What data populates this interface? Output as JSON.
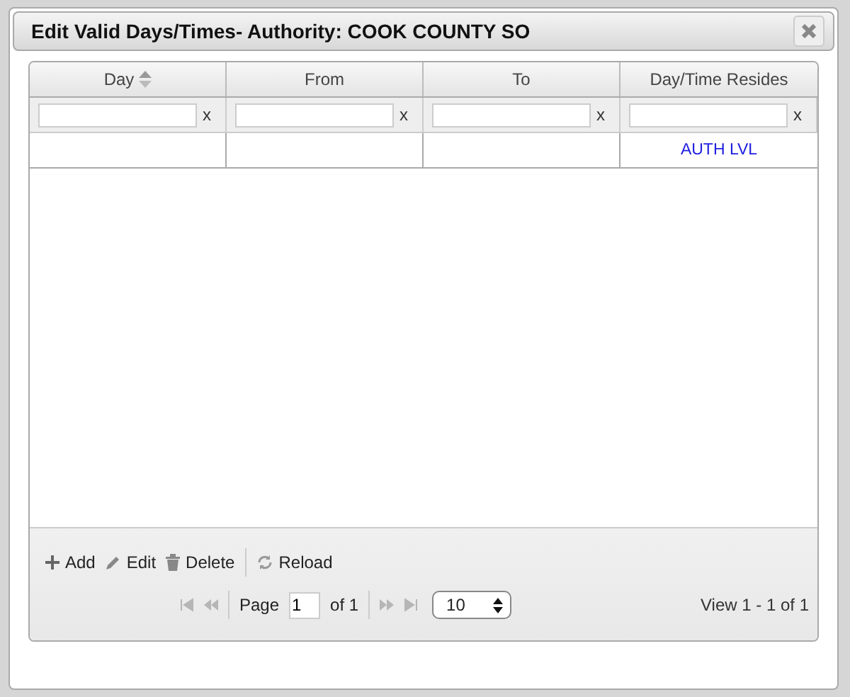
{
  "dialog": {
    "title": "Edit Valid Days/Times- Authority: COOK COUNTY SO"
  },
  "columns": [
    {
      "label": "Day",
      "sortable": true
    },
    {
      "label": "From",
      "sortable": false
    },
    {
      "label": "To",
      "sortable": false
    },
    {
      "label": "Day/Time Resides",
      "sortable": false
    }
  ],
  "filters": [
    {
      "clear": "x"
    },
    {
      "clear": "x"
    },
    {
      "clear": "x"
    },
    {
      "clear": "x"
    }
  ],
  "rows": [
    {
      "day_time_resides": "AUTH LVL"
    }
  ],
  "toolbar": [
    {
      "kind": "add",
      "label": "Add"
    },
    {
      "kind": "edit",
      "label": "Edit"
    },
    {
      "kind": "delete",
      "label": "Delete"
    },
    {
      "kind": "reload",
      "label": "Reload"
    }
  ],
  "pager": {
    "nav": [
      {
        "kind": "first",
        "disabled": true
      },
      {
        "kind": "prev",
        "disabled": true
      },
      {
        "kind": "next",
        "disabled": true
      },
      {
        "kind": "last",
        "disabled": true
      }
    ],
    "page_label": "Page",
    "page": "1",
    "of": "of 1",
    "page_size": "10",
    "view": "View 1 - 1 of 1"
  }
}
